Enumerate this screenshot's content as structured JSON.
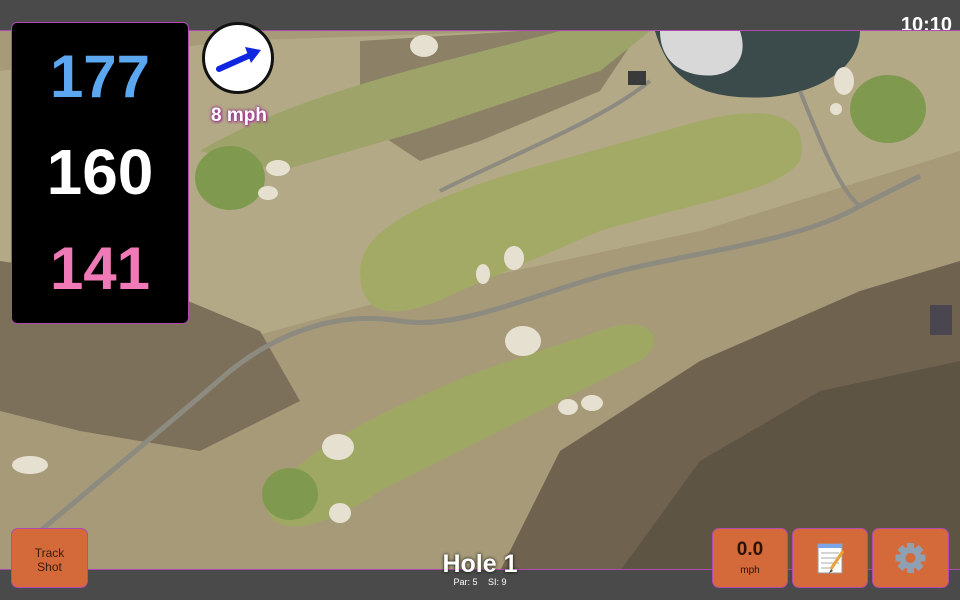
{
  "status": {
    "time": "10:10"
  },
  "distances": {
    "back": "177",
    "middle": "160",
    "front": "141"
  },
  "wind": {
    "speed": "8 mph",
    "direction_icon": "wind-arrow-icon",
    "arrow_color": "#1025e0"
  },
  "hole": {
    "title": "Hole 1",
    "par": "Par: 5",
    "stroke_index": "SI: 9"
  },
  "controls": {
    "track_shot_line1": "Track",
    "track_shot_line2": "Shot",
    "speed_value": "0.0",
    "speed_unit": "mph",
    "notes_icon": "notepad-icon",
    "settings_icon": "gear-icon"
  },
  "colors": {
    "back_distance": "#5ba8f0",
    "middle_distance": "#ffffff",
    "front_distance": "#f07ab8",
    "button": "#d46a3a",
    "border_accent": "#b04ab0"
  }
}
